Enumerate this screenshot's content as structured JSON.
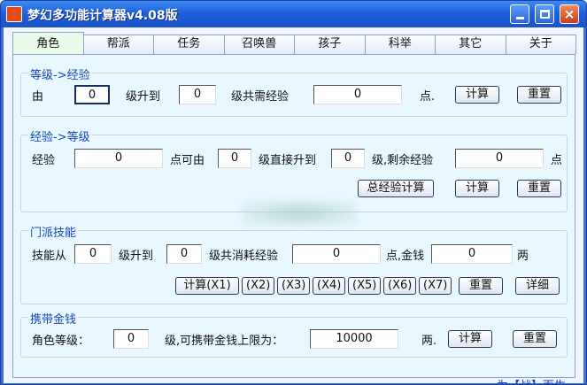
{
  "window": {
    "title": "梦幻多功能计算器v4.08版",
    "minimize_label": "",
    "maximize_label": "",
    "close_label": "×"
  },
  "tabs": [
    "角色",
    "帮派",
    "任务",
    "召唤兽",
    "孩子",
    "科举",
    "其它",
    "关于"
  ],
  "active_tab": "角色",
  "level_to_exp": {
    "title": "等级->经验",
    "from_label": "由",
    "from_value": "0",
    "to_label": "级升到",
    "to_value": "0",
    "need_label": "级共需经验",
    "result_value": "0",
    "unit": "点.",
    "calc_button": "计算",
    "reset_button": "重置"
  },
  "exp_to_level": {
    "title": "经验->等级",
    "exp_label": "经验",
    "exp_value": "0",
    "from_label": "点可由",
    "from_value": "0",
    "direct_label": "级直接升到",
    "to_value": "0",
    "remain_label": "级,剩余经验",
    "remain_value": "0",
    "unit": "点",
    "total_button": "总经验计算",
    "calc_button": "计算",
    "reset_button": "重置"
  },
  "skill": {
    "title": "门派技能",
    "from_label": "技能从",
    "from_value": "0",
    "to_label": "级升到",
    "to_value": "0",
    "cost_label": "级共消耗经验",
    "exp_value": "0",
    "money_label": "点,金钱",
    "money_value": "0",
    "money_unit": "两",
    "calc_buttons": [
      "计算(X1)",
      "(X2)",
      "(X3)",
      "(X4)",
      "(X5)",
      "(X6)",
      "(X7)"
    ],
    "reset_button": "重置",
    "detail_button": "详细"
  },
  "carry_money": {
    "title": "携带金钱",
    "level_label": "角色等级：",
    "level_value": "0",
    "limit_label": "级,可携带金钱上限为：",
    "limit_value": "10000",
    "unit": "两.",
    "calc_button": "计算",
    "reset_button": "重置"
  },
  "footer": "为【战】而生"
}
